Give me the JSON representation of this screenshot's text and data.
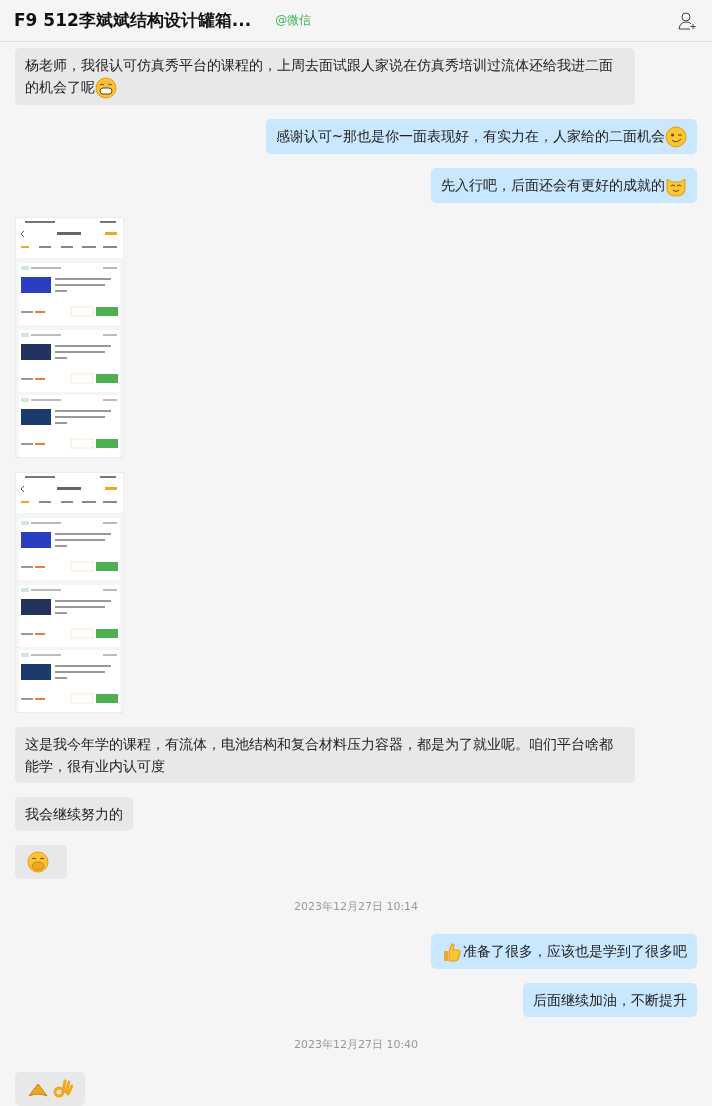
{
  "header": {
    "title": "F9 512李斌斌结构设计罐箱...",
    "source": "@微信"
  },
  "messages": [
    {
      "kind": "text",
      "outgoing": false,
      "text": "杨老师，我很认可仿真秀平台的课程的，上周去面试跟人家说在仿真秀培训过流体还给我进二面的机会了呢",
      "end_emoji": {
        "kind": "grin"
      }
    },
    {
      "kind": "text",
      "outgoing": true,
      "text": "感谢认可~那也是你一面表现好，有实力在，人家给的二面机会",
      "end_emoji": {
        "kind": "wink"
      }
    },
    {
      "kind": "text",
      "outgoing": true,
      "text": "先入行吧，后面还会有更好的成就的",
      "end_emoji": {
        "kind": "cat"
      }
    },
    {
      "kind": "image",
      "outgoing": false
    },
    {
      "kind": "image",
      "outgoing": false
    },
    {
      "kind": "text",
      "outgoing": false,
      "text": "这是我今年学的课程，有流体，电池结构和复合材料压力容器，都是为了就业呢。咱们平台啥都能学，很有业内认可度"
    },
    {
      "kind": "text",
      "outgoing": false,
      "text": "我会继续努力的"
    },
    {
      "kind": "emoji",
      "outgoing": false,
      "emojis": [
        {
          "kind": "giggle"
        }
      ]
    },
    {
      "kind": "time",
      "text": "2023年12月27日 10:14"
    },
    {
      "kind": "text",
      "outgoing": true,
      "start_emoji": {
        "kind": "thumbs"
      },
      "text": "准备了很多，应该也是学到了很多吧"
    },
    {
      "kind": "text",
      "outgoing": true,
      "text": "后面继续加油，不断提升"
    },
    {
      "kind": "time",
      "text": "2023年12月27日 10:40"
    },
    {
      "kind": "emoji",
      "outgoing": false,
      "emojis": [
        {
          "kind": "fist"
        },
        {
          "kind": "ok"
        }
      ]
    }
  ]
}
